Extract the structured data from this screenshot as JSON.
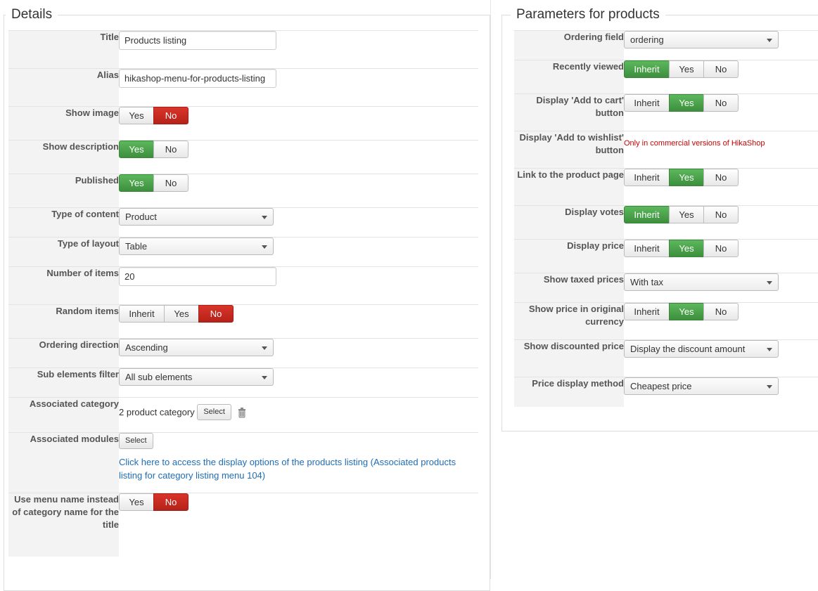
{
  "details": {
    "legend": "Details",
    "rows": {
      "title": {
        "label": "Title",
        "value": "Products listing"
      },
      "alias": {
        "label": "Alias",
        "value": "hikashop-menu-for-products-listing"
      },
      "show_image": {
        "label": "Show image",
        "options": [
          "Yes",
          "No"
        ],
        "selected": "No"
      },
      "show_description": {
        "label": "Show description",
        "options": [
          "Yes",
          "No"
        ],
        "selected": "Yes"
      },
      "published": {
        "label": "Published",
        "options": [
          "Yes",
          "No"
        ],
        "selected": "Yes"
      },
      "type_of_content": {
        "label": "Type of content",
        "value": "Product"
      },
      "type_of_layout": {
        "label": "Type of layout",
        "value": "Table"
      },
      "number_of_items": {
        "label": "Number of items",
        "value": "20"
      },
      "random_items": {
        "label": "Random items",
        "options": [
          "Inherit",
          "Yes",
          "No"
        ],
        "selected": "No"
      },
      "ordering_direction": {
        "label": "Ordering direction",
        "value": "Ascending"
      },
      "sub_elements_filter": {
        "label": "Sub elements filter",
        "value": "All sub elements"
      },
      "associated_category": {
        "label": "Associated category",
        "text": "2 product category",
        "button": "Select"
      },
      "associated_modules": {
        "label": "Associated modules",
        "button": "Select",
        "link": "Click here to access the display options of the products listing (Associated products listing for category listing menu 104)"
      },
      "use_menu_name": {
        "label": "Use menu name instead of category name for the title",
        "options": [
          "Yes",
          "No"
        ],
        "selected": "No"
      }
    }
  },
  "parameters": {
    "legend": "Parameters for products",
    "rows": {
      "ordering_field": {
        "label": "Ordering field",
        "value": "ordering"
      },
      "recently_viewed": {
        "label": "Recently viewed",
        "options": [
          "Inherit",
          "Yes",
          "No"
        ],
        "selected": "Inherit"
      },
      "add_to_cart": {
        "label": "Display 'Add to cart' button",
        "options": [
          "Inherit",
          "Yes",
          "No"
        ],
        "selected": "Yes"
      },
      "add_to_wishlist": {
        "label": "Display 'Add to wishlist' button",
        "note": "Only in commercial versions of HikaShop"
      },
      "link_to_product": {
        "label": "Link to the product page",
        "options": [
          "Inherit",
          "Yes",
          "No"
        ],
        "selected": "Yes"
      },
      "display_votes": {
        "label": "Display votes",
        "options": [
          "Inherit",
          "Yes",
          "No"
        ],
        "selected": "Inherit"
      },
      "display_price": {
        "label": "Display price",
        "options": [
          "Inherit",
          "Yes",
          "No"
        ],
        "selected": "Yes"
      },
      "show_taxed_prices": {
        "label": "Show taxed prices",
        "value": "With tax"
      },
      "show_original_currency": {
        "label": "Show price in original currency",
        "options": [
          "Inherit",
          "Yes",
          "No"
        ],
        "selected": "Yes"
      },
      "show_discounted_price": {
        "label": "Show discounted price",
        "value": "Display the discount amount"
      },
      "price_display_method": {
        "label": "Price display method",
        "value": "Cheapest price"
      }
    }
  },
  "colors": {
    "active_green": "#4cae4c",
    "active_red": "#c9302c",
    "link_blue": "#1e6db4",
    "note_red": "#cc0000"
  }
}
